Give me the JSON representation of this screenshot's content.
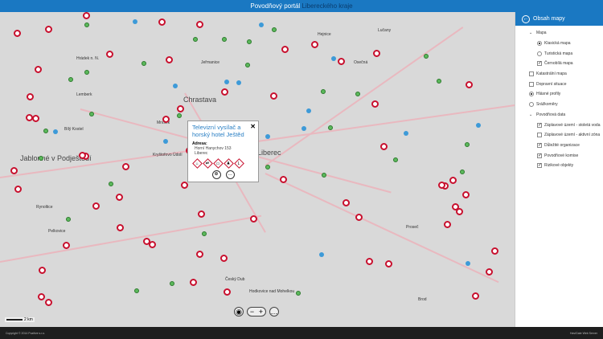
{
  "header": {
    "title_prefix": "Povodňový portál",
    "title_accent": "Libereckého kraje"
  },
  "map": {
    "places": [
      "Chrastava",
      "Jablonné v Podještědí",
      "Liberec",
      "Hrádek n. N.",
      "Hejnice",
      "Bílý Kostel",
      "Kryštofovo Údolí",
      "Proseč",
      "Lučany",
      "Mníšek",
      "Hodkovice nad Mohelkou",
      "Brod",
      "Osečná",
      "Český Dub",
      "Lemberk",
      "Rynoltice",
      "Pelkovice",
      "Jeřmanice"
    ],
    "scale": "2 km"
  },
  "popup": {
    "title": "Televizní vysílač a horský hotel Ještěd",
    "address_label": "Adresa:",
    "address_lines": [
      "Horní Hanychov 153",
      "Liberec"
    ],
    "close": "✕",
    "hazard_icons": [
      "⌂",
      "⇄",
      "▭",
      "♟",
      "L"
    ],
    "zoom_btn": "⊕",
    "more_btn": "…"
  },
  "controls": {
    "locate": "◉",
    "zoom_out": "−",
    "zoom_in": "+",
    "more": "…"
  },
  "panel": {
    "title": "Obsah mapy",
    "back": "←",
    "items": [
      {
        "label": "Mapa",
        "type": "group",
        "level": 0
      },
      {
        "label": "Klasická mapa",
        "type": "radio",
        "checked": true,
        "level": 1
      },
      {
        "label": "Turistická mapa",
        "type": "radio",
        "checked": false,
        "level": 1
      },
      {
        "label": "Černobílá mapa",
        "type": "check",
        "checked": true,
        "level": 1
      },
      {
        "label": "Katastrální mapa",
        "type": "check",
        "checked": false,
        "level": 0
      },
      {
        "label": "Dopravní situace",
        "type": "check",
        "checked": false,
        "level": 0
      },
      {
        "label": "Hlásné profily",
        "type": "radio",
        "checked": true,
        "level": 0
      },
      {
        "label": "Srážkoměry",
        "type": "radio",
        "checked": false,
        "level": 0
      },
      {
        "label": "Povodňová data",
        "type": "group",
        "level": 0
      },
      {
        "label": "Záplavové území - stoletá voda",
        "type": "check",
        "checked": true,
        "level": 1
      },
      {
        "label": "Záplavové území - aktivní zóna",
        "type": "check",
        "checked": false,
        "level": 1
      },
      {
        "label": "Důležité organizace",
        "type": "check",
        "checked": true,
        "level": 1
      },
      {
        "label": "Povodňové komise",
        "type": "check",
        "checked": true,
        "level": 1
      },
      {
        "label": "Rizikové objekty",
        "type": "check",
        "checked": true,
        "level": 1
      }
    ]
  },
  "footer": {
    "copyright": "Copyright © 2014 Pozitive s.r.o.",
    "server": "HaviGate Web Server"
  }
}
